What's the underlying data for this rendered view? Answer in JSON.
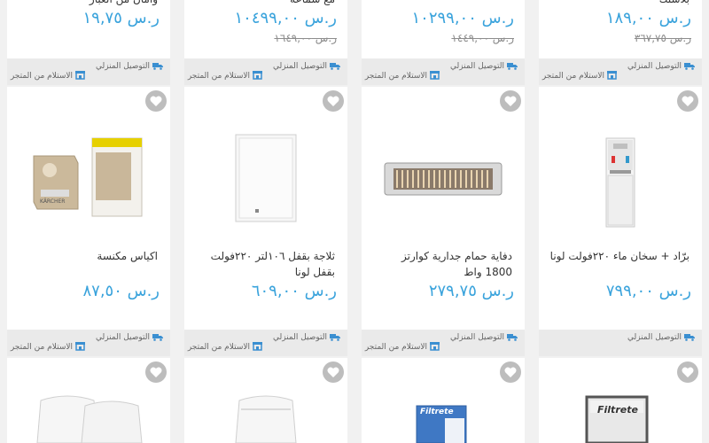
{
  "shipping": {
    "delivery_label": "التوصيل المنزلي",
    "pickup_label": "الاستلام من المتجر"
  },
  "top_row": [
    {
      "title": "بلاستك",
      "price": "ر.س ١٨٩,٠٠",
      "old_price": "ر.س ٣٦٧,٧٥"
    },
    {
      "title": "",
      "price": "ر.س ١٠٢٩٩,٠٠",
      "old_price": "ر.س ١٤٤٩,٠٠"
    },
    {
      "title": "مع سماعة",
      "price": "ر.س ١٠٤٩٩,٠٠",
      "old_price": "ر.س ١٦٤٩,٠٠"
    },
    {
      "title": "وأمان من الغبار",
      "price": "ر.س ١٩,٧٥",
      "old_price": ""
    }
  ],
  "middle_row": [
    {
      "title": "برّاد + سخان ماء ٢٢٠فولت لونا",
      "price": "ر.س ٧٩٩,٠٠",
      "image": "water-dispenser"
    },
    {
      "title": "دفاية حمام جدارية كوارتز 1800 واط",
      "price": "ر.س ٢٧٩,٧٥",
      "image": "quartz-heater"
    },
    {
      "title": "ثلاجة بقفل ١٠٦لتر ٢٢٠فولت بقفل لونا",
      "price": "ر.س ٦٠٩,٠٠",
      "image": "mini-fridge"
    },
    {
      "title": "اكياس مكنسة",
      "price": "ر.س ٨٧,٥٠",
      "image": "vacuum-bags",
      "brand": "KÄRCHER"
    }
  ],
  "bottom_row": [
    {
      "image": "filtrete-filter",
      "brand": "Filtrete"
    },
    {
      "image": "filtrete-box",
      "brand": "Filtrete"
    },
    {
      "image": "air-purifier"
    },
    {
      "image": "air-purifier-pair"
    }
  ],
  "colors": {
    "price": "#3aa3dc",
    "heart_bg": "#bdbdbd",
    "ship_bar": "#eaeaea"
  }
}
